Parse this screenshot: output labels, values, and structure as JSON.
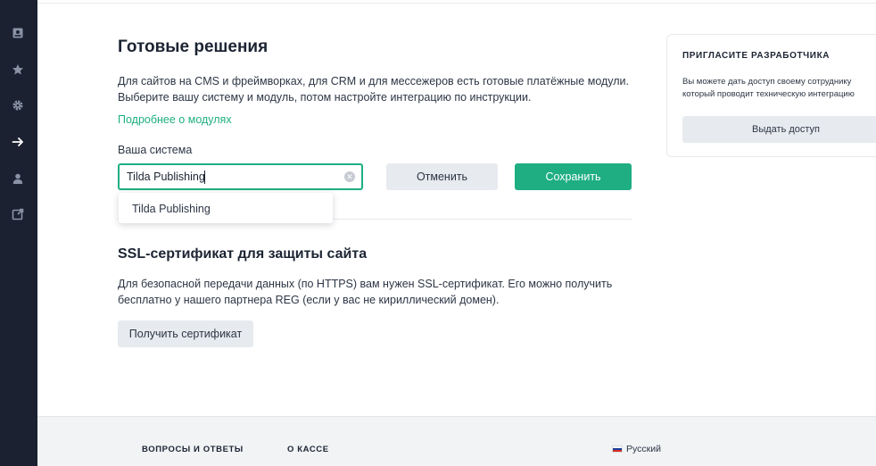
{
  "sidebar": {
    "items": [
      {
        "icon": "document-icon",
        "active": false
      },
      {
        "icon": "star-icon",
        "active": false
      },
      {
        "icon": "gear-icon",
        "active": false
      },
      {
        "icon": "arrow-right-icon",
        "active": true
      },
      {
        "icon": "user-icon",
        "active": false
      },
      {
        "icon": "external-link-icon",
        "active": false
      }
    ]
  },
  "modules": {
    "title": "Готовые решения",
    "description_line1": "Для сайтов на CMS и фреймворках, для CRM и для мессежеров есть готовые платёжные модули.",
    "description_line2": "Выберите вашу систему и модуль, потом настройте интеграцию по инструкции.",
    "more_link": "Подробнее о модулях",
    "system_label": "Ваша система",
    "system_value": "Tilda Publishing",
    "cancel_label": "Отменить",
    "save_label": "Сохранить",
    "suggestion": "Tilda Publishing"
  },
  "ssl": {
    "title": "SSL-сертификат для защиты сайта",
    "description_line1": "Для безопасной передачи данных (по HTTPS) вам нужен SSL-сертификат. Его можно получить",
    "description_line2": "бесплатно у нашего партнера REG (если у вас не кириллический домен).",
    "button_label": "Получить сертификат"
  },
  "invite": {
    "title": "ПРИГЛАСИТЕ РАЗРАБОТЧИКА",
    "text_line1": "Вы можете дать доступ своему сотруднику",
    "text_line2": "который проводит техническую интеграцию",
    "button_label": "Выдать доступ"
  },
  "footer": {
    "faq": "ВОПРОСЫ И ОТВЕТЫ",
    "about": "О КАССЕ",
    "language": "Русский"
  },
  "colors": {
    "accent": "#1eae82",
    "sidebar": "#1b2131",
    "icon_inactive": "#8a93a6",
    "icon_active": "#ffffff"
  }
}
